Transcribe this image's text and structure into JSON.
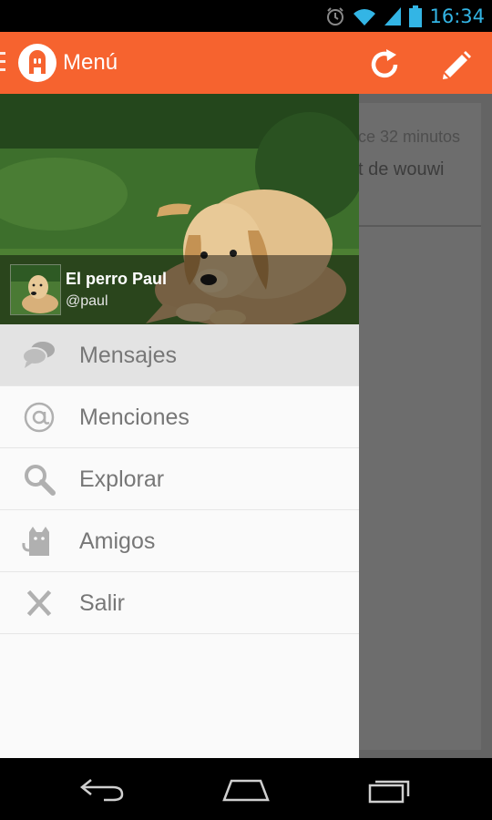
{
  "status_bar": {
    "time": "16:34"
  },
  "action_bar": {
    "title": "Menú",
    "color": "#f6632f"
  },
  "background_content": {
    "time_fragment": "ce 32 minutos",
    "text_fragment": "t de wouwi"
  },
  "drawer": {
    "profile": {
      "name": "El perro Paul",
      "handle": "@paul"
    },
    "items": [
      {
        "label": "Mensajes",
        "icon": "speech-bubbles-icon",
        "selected": true
      },
      {
        "label": "Menciones",
        "icon": "at-sign-icon",
        "selected": false
      },
      {
        "label": "Explorar",
        "icon": "magnifier-icon",
        "selected": false
      },
      {
        "label": "Amigos",
        "icon": "cat-icon",
        "selected": false
      },
      {
        "label": "Salir",
        "icon": "close-icon",
        "selected": false
      }
    ]
  },
  "nav_bar": {
    "buttons": [
      "back-icon",
      "home-icon",
      "recent-apps-icon"
    ]
  }
}
